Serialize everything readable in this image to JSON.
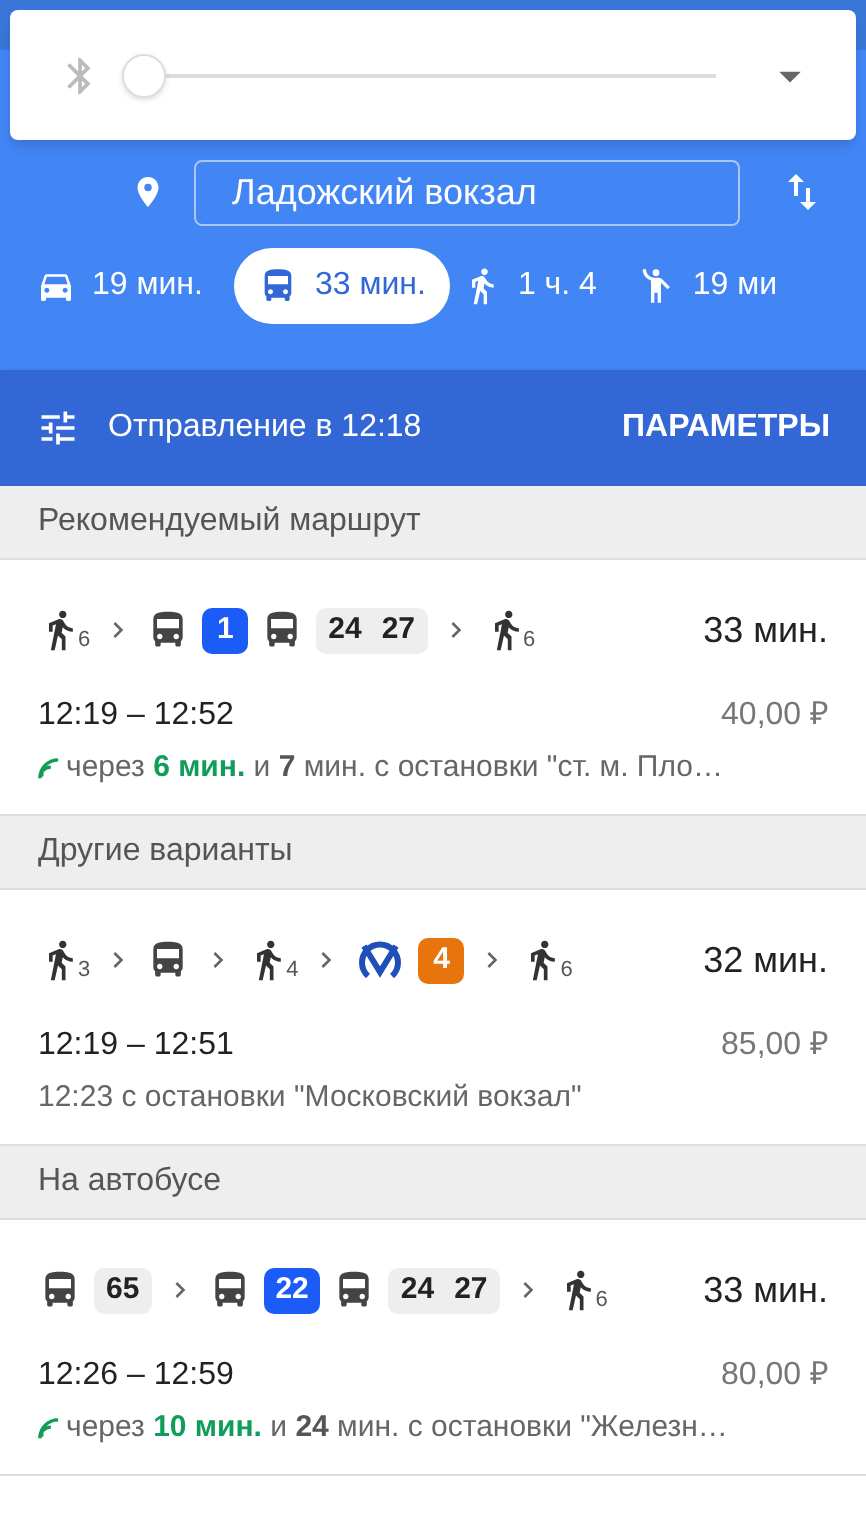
{
  "volume_popup": {
    "level": 0
  },
  "destination": {
    "value": "Ладожский вокзал"
  },
  "modes": [
    {
      "kind": "car",
      "label": "19 мин.",
      "selected": false
    },
    {
      "kind": "transit",
      "label": "33 мин.",
      "selected": true
    },
    {
      "kind": "walk",
      "label": "1 ч. 4",
      "selected": false
    },
    {
      "kind": "ride",
      "label": "19 ми",
      "selected": false
    }
  ],
  "departure_bar": {
    "text": "Отправление в 12:18",
    "button": "ПАРАМЕТРЫ"
  },
  "sections": [
    {
      "title": "Рекомендуемый маршрут",
      "routes": [
        {
          "segments": [
            {
              "kind": "walk",
              "count": "6"
            },
            {
              "kind": "arrow"
            },
            {
              "kind": "bus"
            },
            {
              "kind": "badge",
              "label": "1",
              "color": "#1a5cf5"
            },
            {
              "kind": "bus"
            },
            {
              "kind": "pair",
              "labels": [
                "24",
                "27"
              ]
            },
            {
              "kind": "arrow"
            },
            {
              "kind": "walk",
              "count": "6"
            }
          ],
          "duration": "33 мин.",
          "times": "12:19 – 12:52",
          "price": "40,00 ₽",
          "details": {
            "live": true,
            "lead": "через",
            "wait": "6 мин.",
            "rest": "и **7** мин. с остановки \"ст. м. Пло…"
          }
        }
      ]
    },
    {
      "title": "Другие варианты",
      "routes": [
        {
          "segments": [
            {
              "kind": "walk",
              "count": "3"
            },
            {
              "kind": "arrow"
            },
            {
              "kind": "bus"
            },
            {
              "kind": "arrow"
            },
            {
              "kind": "walk",
              "count": "4"
            },
            {
              "kind": "arrow"
            },
            {
              "kind": "metro"
            },
            {
              "kind": "badge",
              "label": "4",
              "color": "#e8740c"
            },
            {
              "kind": "arrow"
            },
            {
              "kind": "walk",
              "count": "6"
            }
          ],
          "duration": "32 мин.",
          "times": "12:19 – 12:51",
          "price": "85,00 ₽",
          "details": {
            "live": false,
            "rest": "12:23 с остановки \"Московский вокзал\""
          }
        }
      ]
    },
    {
      "title": "На автобусе",
      "routes": [
        {
          "segments": [
            {
              "kind": "bus"
            },
            {
              "kind": "badge",
              "label": "65",
              "color": "#eeeeee"
            },
            {
              "kind": "arrow"
            },
            {
              "kind": "bus"
            },
            {
              "kind": "badge",
              "label": "22",
              "color": "#1a5cf5"
            },
            {
              "kind": "bus"
            },
            {
              "kind": "pair",
              "labels": [
                "24",
                "27"
              ]
            },
            {
              "kind": "arrow"
            },
            {
              "kind": "walk",
              "count": "6"
            }
          ],
          "duration": "33 мин.",
          "times": "12:26 – 12:59",
          "price": "80,00 ₽",
          "details": {
            "live": true,
            "lead": "через",
            "wait": "10 мин.",
            "rest": "и **24** мин. с остановки \"Железн…"
          }
        }
      ]
    }
  ]
}
